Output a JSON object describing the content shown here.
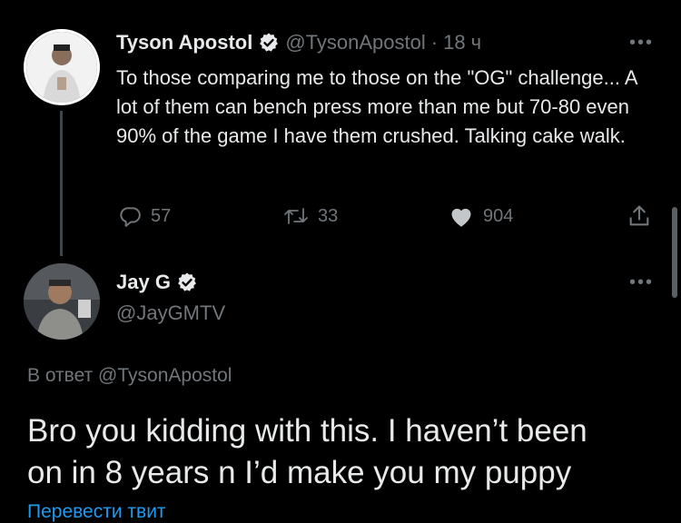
{
  "tweet": {
    "author_name": "Tyson Apostol",
    "author_handle": "@TysonApostol",
    "separator": "·",
    "time": "18 ч",
    "text": "To those comparing me to those on the \"OG\" challenge... A lot of them can bench press more than me but 70-80 even 90% of the game I have them crushed. Talking cake walk.",
    "replies": "57",
    "retweets": "33",
    "likes": "904"
  },
  "reply": {
    "author_name": "Jay G",
    "author_handle": "@JayGMTV",
    "reply_to_prefix": "В ответ",
    "reply_to_handle": "@TysonApostol",
    "text_line1": "Bro you kidding with this. I haven’t been",
    "text_line2": "on in 8 years n I’d make you my puppy",
    "translate_label": "Перевести твит"
  },
  "ui": {
    "more_glyph": "•••",
    "verified_color": "#e7e9ea",
    "background": "#000000"
  }
}
